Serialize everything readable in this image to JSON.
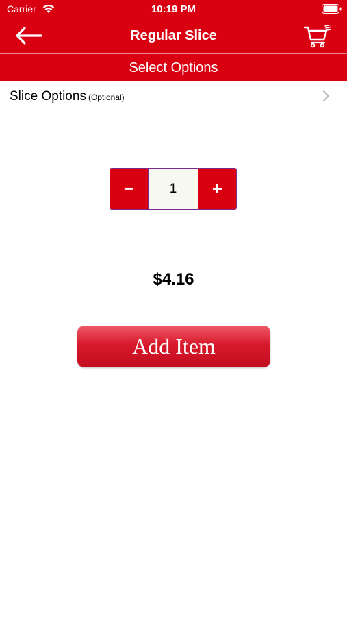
{
  "status_bar": {
    "carrier": "Carrier",
    "time": "10:19 PM"
  },
  "nav": {
    "title": "Regular Slice"
  },
  "sub_header": {
    "label": "Select Options"
  },
  "option": {
    "label": "Slice Options",
    "note": "(Optional)"
  },
  "stepper": {
    "minus_label": "−",
    "value": "1",
    "plus_label": "+"
  },
  "price": "$4.16",
  "add_button_label": "Add Item",
  "colors": {
    "brand_red": "#d90012",
    "stepper_border": "#7b2a8c"
  }
}
